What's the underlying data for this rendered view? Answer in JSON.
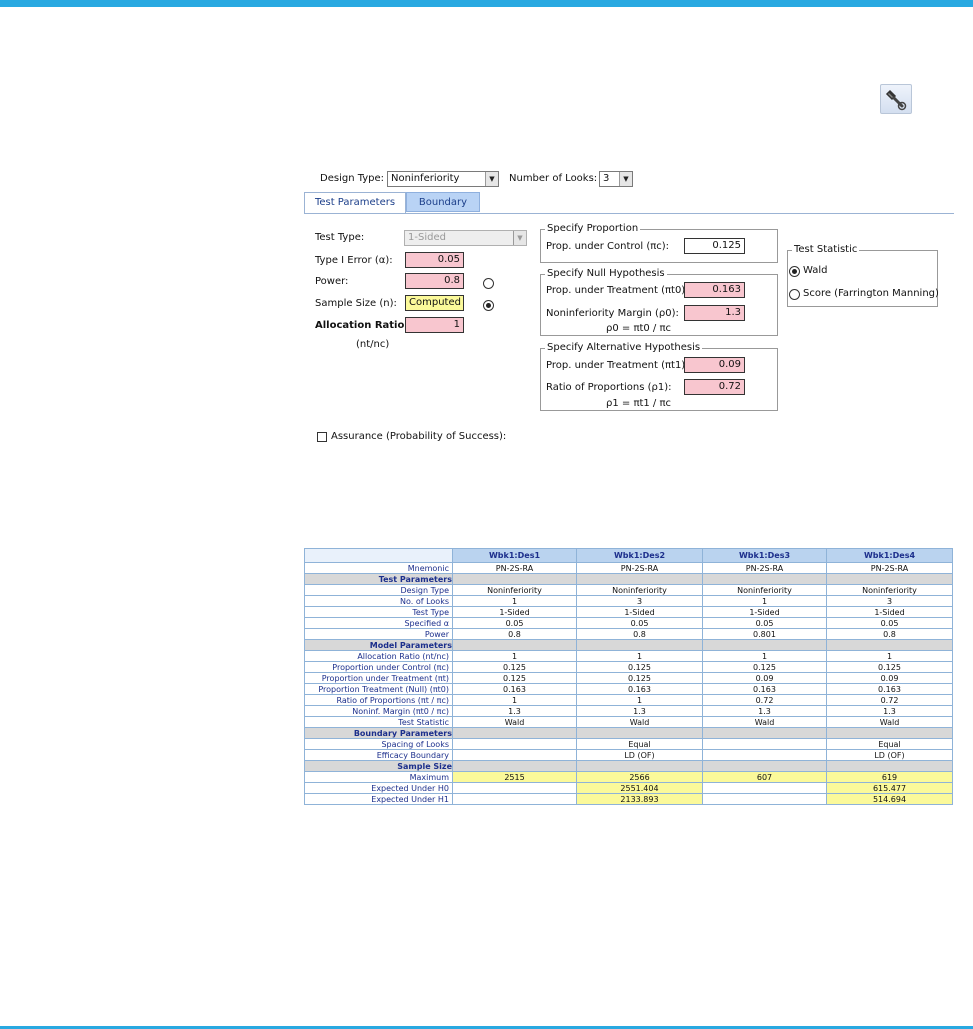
{
  "header": {
    "design_type_label": "Design Type:",
    "design_type_value": "Noninferiority",
    "looks_label": "Number of Looks:",
    "looks_value": "3"
  },
  "tabs": [
    {
      "label": "Test Parameters"
    },
    {
      "label": "Boundary"
    }
  ],
  "test_params": {
    "test_type_label": "Test Type:",
    "test_type_value": "1-Sided",
    "alpha_label": "Type I Error (α):",
    "alpha_value": "0.05",
    "power_label": "Power:",
    "power_value": "0.8",
    "sample_size_label": "Sample Size (n):",
    "sample_size_value": "Computed",
    "allocation_label": "Allocation Ratio:",
    "allocation_value": "1",
    "allocation_formula": "(nt/nc)"
  },
  "specify_proportion": {
    "legend": "Specify Proportion",
    "control_label": "Prop. under Control (πc):",
    "control_value": "0.125"
  },
  "null_hypothesis": {
    "legend": "Specify Null Hypothesis",
    "treatment_label": "Prop. under Treatment (πt0):",
    "treatment_value": "0.163",
    "margin_label": "Noninferiority Margin (ρ0):",
    "margin_value": "1.3",
    "formula": "ρ0 = πt0 / πc"
  },
  "alt_hypothesis": {
    "legend": "Specify Alternative Hypothesis",
    "treatment_label": "Prop. under Treatment (πt1):",
    "treatment_value": "0.09",
    "ratio_label": "Ratio of Proportions (ρ1):",
    "ratio_value": "0.72",
    "formula": "ρ1 = πt1 / πc"
  },
  "test_statistic": {
    "legend": "Test Statistic",
    "options": [
      {
        "label": "Wald",
        "selected": true
      },
      {
        "label": "Score (Farrington Manning)",
        "selected": false
      }
    ]
  },
  "assurance_label": "Assurance (Probability of Success):",
  "table": {
    "columns": [
      "Wbk1:Des1",
      "Wbk1:Des2",
      "Wbk1:Des3",
      "Wbk1:Des4"
    ],
    "rows": [
      {
        "label": "Mnemonic",
        "values": [
          "PN-2S-RA",
          "PN-2S-RA",
          "PN-2S-RA",
          "PN-2S-RA"
        ]
      },
      {
        "section": "Test Parameters"
      },
      {
        "label": "Design Type",
        "values": [
          "Noninferiority",
          "Noninferiority",
          "Noninferiority",
          "Noninferiority"
        ]
      },
      {
        "label": "No. of Looks",
        "values": [
          "1",
          "3",
          "1",
          "3"
        ]
      },
      {
        "label": "Test Type",
        "values": [
          "1-Sided",
          "1-Sided",
          "1-Sided",
          "1-Sided"
        ]
      },
      {
        "label": "Specified α",
        "values": [
          "0.05",
          "0.05",
          "0.05",
          "0.05"
        ]
      },
      {
        "label": "Power",
        "values": [
          "0.8",
          "0.8",
          "0.801",
          "0.8"
        ]
      },
      {
        "section": "Model Parameters"
      },
      {
        "label": "Allocation Ratio (nt/nc)",
        "values": [
          "1",
          "1",
          "1",
          "1"
        ]
      },
      {
        "label": "Proportion under Control (πc)",
        "values": [
          "0.125",
          "0.125",
          "0.125",
          "0.125"
        ]
      },
      {
        "label": "Proportion under Treatment (πt)",
        "values": [
          "0.125",
          "0.125",
          "0.09",
          "0.09"
        ]
      },
      {
        "label": "Proportion Treatment (Null) (πt0)",
        "values": [
          "0.163",
          "0.163",
          "0.163",
          "0.163"
        ]
      },
      {
        "label": "Ratio of Proportions (πt / πc)",
        "values": [
          "1",
          "1",
          "0.72",
          "0.72"
        ]
      },
      {
        "label": "Noninf. Margin (πt0 / πc)",
        "values": [
          "1.3",
          "1.3",
          "1.3",
          "1.3"
        ]
      },
      {
        "label": "Test Statistic",
        "values": [
          "Wald",
          "Wald",
          "Wald",
          "Wald"
        ]
      },
      {
        "section": "Boundary Parameters"
      },
      {
        "label": "Spacing of Looks",
        "values": [
          "",
          "Equal",
          "",
          "Equal"
        ]
      },
      {
        "label": "Efficacy Boundary",
        "values": [
          "",
          "LD (OF)",
          "",
          "LD (OF)"
        ]
      },
      {
        "section": "Sample Size"
      },
      {
        "label": "Maximum",
        "values": [
          "2515",
          "2566",
          "607",
          "619"
        ],
        "highlight": [
          true,
          true,
          true,
          true
        ]
      },
      {
        "label": "Expected Under H0",
        "values": [
          "",
          "2551.404",
          "",
          "615.477"
        ],
        "highlight": [
          false,
          true,
          false,
          true
        ]
      },
      {
        "label": "Expected Under H1",
        "values": [
          "",
          "2133.893",
          "",
          "514.694"
        ],
        "highlight": [
          false,
          true,
          false,
          true
        ]
      }
    ]
  }
}
